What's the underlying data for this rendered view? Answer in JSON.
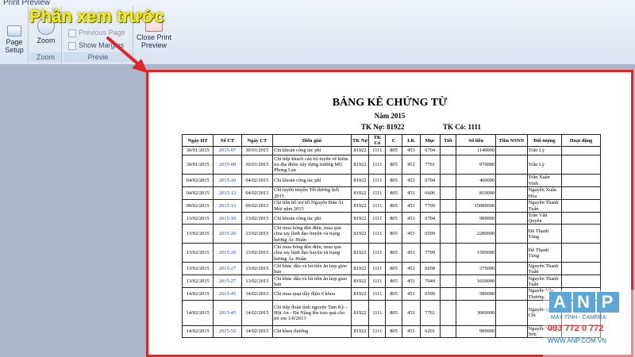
{
  "ribbon": {
    "tab": "Print Preview",
    "groups": {
      "print": {
        "btn": "Page\nSetup"
      },
      "zoom": {
        "btn": "Zoom",
        "label": "Zoom"
      },
      "preview": {
        "prev": "Previous Page",
        "show": "Show Margins",
        "label": "Previe",
        "close": "Close Print\nPreview"
      }
    }
  },
  "caption": "Phần xem trước",
  "document": {
    "title": "BẢNG KÊ CHỨNG TỪ",
    "year": "Năm 2015",
    "tk_no": "TK Nợ: 81922",
    "tk_co": "TK Có: 1111",
    "headers": [
      "Ngày HT",
      "Số CT",
      "Ngày CT",
      "Diễn giải",
      "TK Nợ",
      "TK Có",
      "C",
      "LK",
      "Mục",
      "Tiết",
      "Số tiền",
      "Tiền NSNN",
      "Đối tượng",
      "Hoạt động"
    ],
    "rows": [
      [
        "30/01/2015",
        "2015-07",
        "30/01/2015",
        "Chi khoán công tác phí",
        "81922",
        "1111",
        "805",
        "453",
        "6704",
        "",
        "1140000",
        "",
        "Trần Lý",
        ""
      ],
      [
        "30/01/2015",
        "2015-08",
        "30/01/2015",
        "Chi tiếp khách cán bộ tuyên về kiểm tra địa điểm xây dựng trường MG Phong Lan",
        "81922",
        "1111",
        "805",
        "453",
        "7761",
        "",
        "970000",
        "",
        "Trần Lý",
        ""
      ],
      [
        "04/02/2015",
        "2015-10",
        "04/02/2015",
        "Chi khoán công tác phí",
        "81922",
        "1111",
        "805",
        "453",
        "6704",
        "",
        "460000",
        "",
        "Trần Xuân Vinh",
        ""
      ],
      [
        "04/02/2015",
        "2015-12",
        "04/02/2015",
        "Chi tuyên truyền Tết dương lịch 2015",
        "81922",
        "1111",
        "805",
        "453",
        "6606",
        "",
        "810000",
        "",
        "Nguyễn Xuân Hòa",
        ""
      ],
      [
        "09/02/2015",
        "2015-13",
        "09/02/2015",
        "Chi tiền hỗ trợ tết Nguyên Đán Ất Mùi năm 2015",
        "81922",
        "1111",
        "805",
        "453",
        "7799",
        "",
        "15000000",
        "",
        "Nguyễn Thanh Tuấn",
        ""
      ],
      [
        "13/02/2015",
        "2015-19",
        "13/02/2015",
        "Chi khoán công tác phí",
        "81922",
        "1111",
        "805",
        "453",
        "6704",
        "",
        "900000",
        "",
        "Trần Văn Quyên",
        ""
      ],
      [
        "13/02/2015",
        "2015-26",
        "13/02/2015",
        "Chi mua bóng đèn điện, mua quà chia tay lãnh đạo huyện và trạng hương Ác Huân",
        "81922",
        "1111",
        "805",
        "453",
        "6599",
        "",
        "2280000",
        "",
        "Đỗ Thanh Tùng",
        ""
      ],
      [
        "13/02/2015",
        "2015-26",
        "13/02/2015",
        "Chi mua bóng đèn điện, mua quà chia tay lãnh đạo huyện và trạng hương Ác Huân",
        "81922",
        "1111",
        "805",
        "453",
        "7799",
        "",
        "1500000",
        "",
        "Đỗ Thanh Tùng",
        ""
      ],
      [
        "13/02/2015",
        "2015-27",
        "13/02/2015",
        "Chi khác dầu và bù tiền ăn họp giao ban",
        "81922",
        "1111",
        "805",
        "453",
        "6658",
        "",
        "375000",
        "",
        "Nguyễn Thanh Tuấn",
        ""
      ],
      [
        "13/02/2015",
        "2015-27",
        "13/02/2015",
        "Chi khác dầu và bù tiền ăn họp giao ban",
        "81922",
        "1111",
        "805",
        "453",
        "7049",
        "",
        "1650000",
        "",
        "Nguyễn Thanh Tuấn",
        ""
      ],
      [
        "14/02/2015",
        "2015-45",
        "14/02/2015",
        "Chi mua quạt dây điện ở khoa",
        "81922",
        "1111",
        "805",
        "453",
        "6599",
        "",
        "580000",
        "",
        "Nguyễn Văn Thương",
        ""
      ],
      [
        "14/02/2015",
        "2015-45",
        "14/02/2015",
        "Chi tiếp đoàn tình nguyện Tam Kỳ - Hội An - Đà Nẵng lên trao quà cho trẻ em 1/6/2013",
        "81922",
        "1111",
        "805",
        "453",
        "7761",
        "",
        "3000000",
        "",
        "Nguyễn Quốc Chi",
        ""
      ],
      [
        "14/02/2015",
        "2015-52",
        "14/02/2015",
        "Chi khen thưởng",
        "81922",
        "1111",
        "805",
        "453",
        "6201",
        "",
        "900000",
        "",
        "Nguyễn Văn Sơn",
        ""
      ]
    ]
  },
  "watermark": {
    "letters": [
      "A",
      "N",
      "P"
    ],
    "sub": "MÁY TÍNH - CAMERA",
    "phone": "093 772 0 772",
    "site": "WWW.ANP.COM.VN"
  },
  "colors": {
    "highlight": "#e32424",
    "caption": "#ffee00",
    "link": "#1c3fd1"
  }
}
